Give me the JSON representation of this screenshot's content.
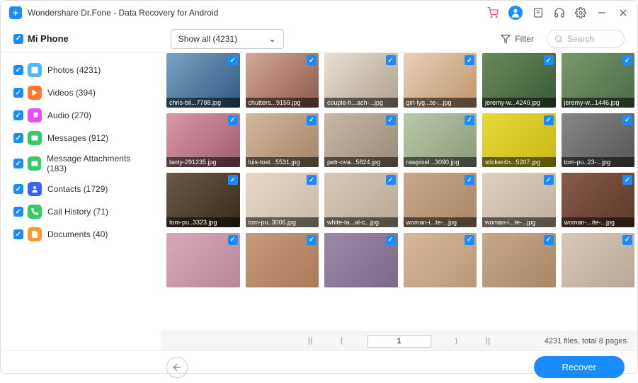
{
  "titlebar": {
    "title": "Wondershare Dr.Fone - Data Recovery for Android"
  },
  "device": {
    "label": "Mi Phone"
  },
  "dropdown": {
    "label": "Show all (4231)"
  },
  "filter": {
    "label": "Filter"
  },
  "search": {
    "placeholder": "Search"
  },
  "sidebar": {
    "items": [
      {
        "label": "Photos (4231)"
      },
      {
        "label": "Videos (394)"
      },
      {
        "label": "Audio (270)"
      },
      {
        "label": "Messages (912)"
      },
      {
        "label": "Message Attachments (183)"
      },
      {
        "label": "Contacts (1729)"
      },
      {
        "label": "Call History (71)"
      },
      {
        "label": "Documents (40)"
      }
    ]
  },
  "grid": [
    {
      "file": "chris-bil...7788.jpg"
    },
    {
      "file": "chutters...9159.jpg"
    },
    {
      "file": "couple-h...ach-...jpg"
    },
    {
      "file": "girl-lyg...te-...jpg"
    },
    {
      "file": "jeremy-w...4240.jpg"
    },
    {
      "file": "jeremy-w...1446.jpg"
    },
    {
      "file": "lanty-291235.jpg"
    },
    {
      "file": "luis-tost...5531.jpg"
    },
    {
      "file": "petr-ova...5824.jpg"
    },
    {
      "file": "rawpixel...3090.jpg"
    },
    {
      "file": "sticker4n...5207.jpg"
    },
    {
      "file": "tom-pu..23-...jpg"
    },
    {
      "file": "tom-pu..3323.jpg"
    },
    {
      "file": "tom-pu..3006.jpg"
    },
    {
      "file": "white-ta...al-c...jpg"
    },
    {
      "file": "woman-i...te-...jpg"
    },
    {
      "file": "woman-i...te-...jpg"
    },
    {
      "file": "woman-...ite-...jpg"
    },
    {
      "file": ""
    },
    {
      "file": ""
    },
    {
      "file": ""
    },
    {
      "file": ""
    },
    {
      "file": ""
    },
    {
      "file": ""
    }
  ],
  "pager": {
    "page": "1",
    "info": "4231 files, total 8 pages."
  },
  "footer": {
    "recover": "Recover"
  }
}
